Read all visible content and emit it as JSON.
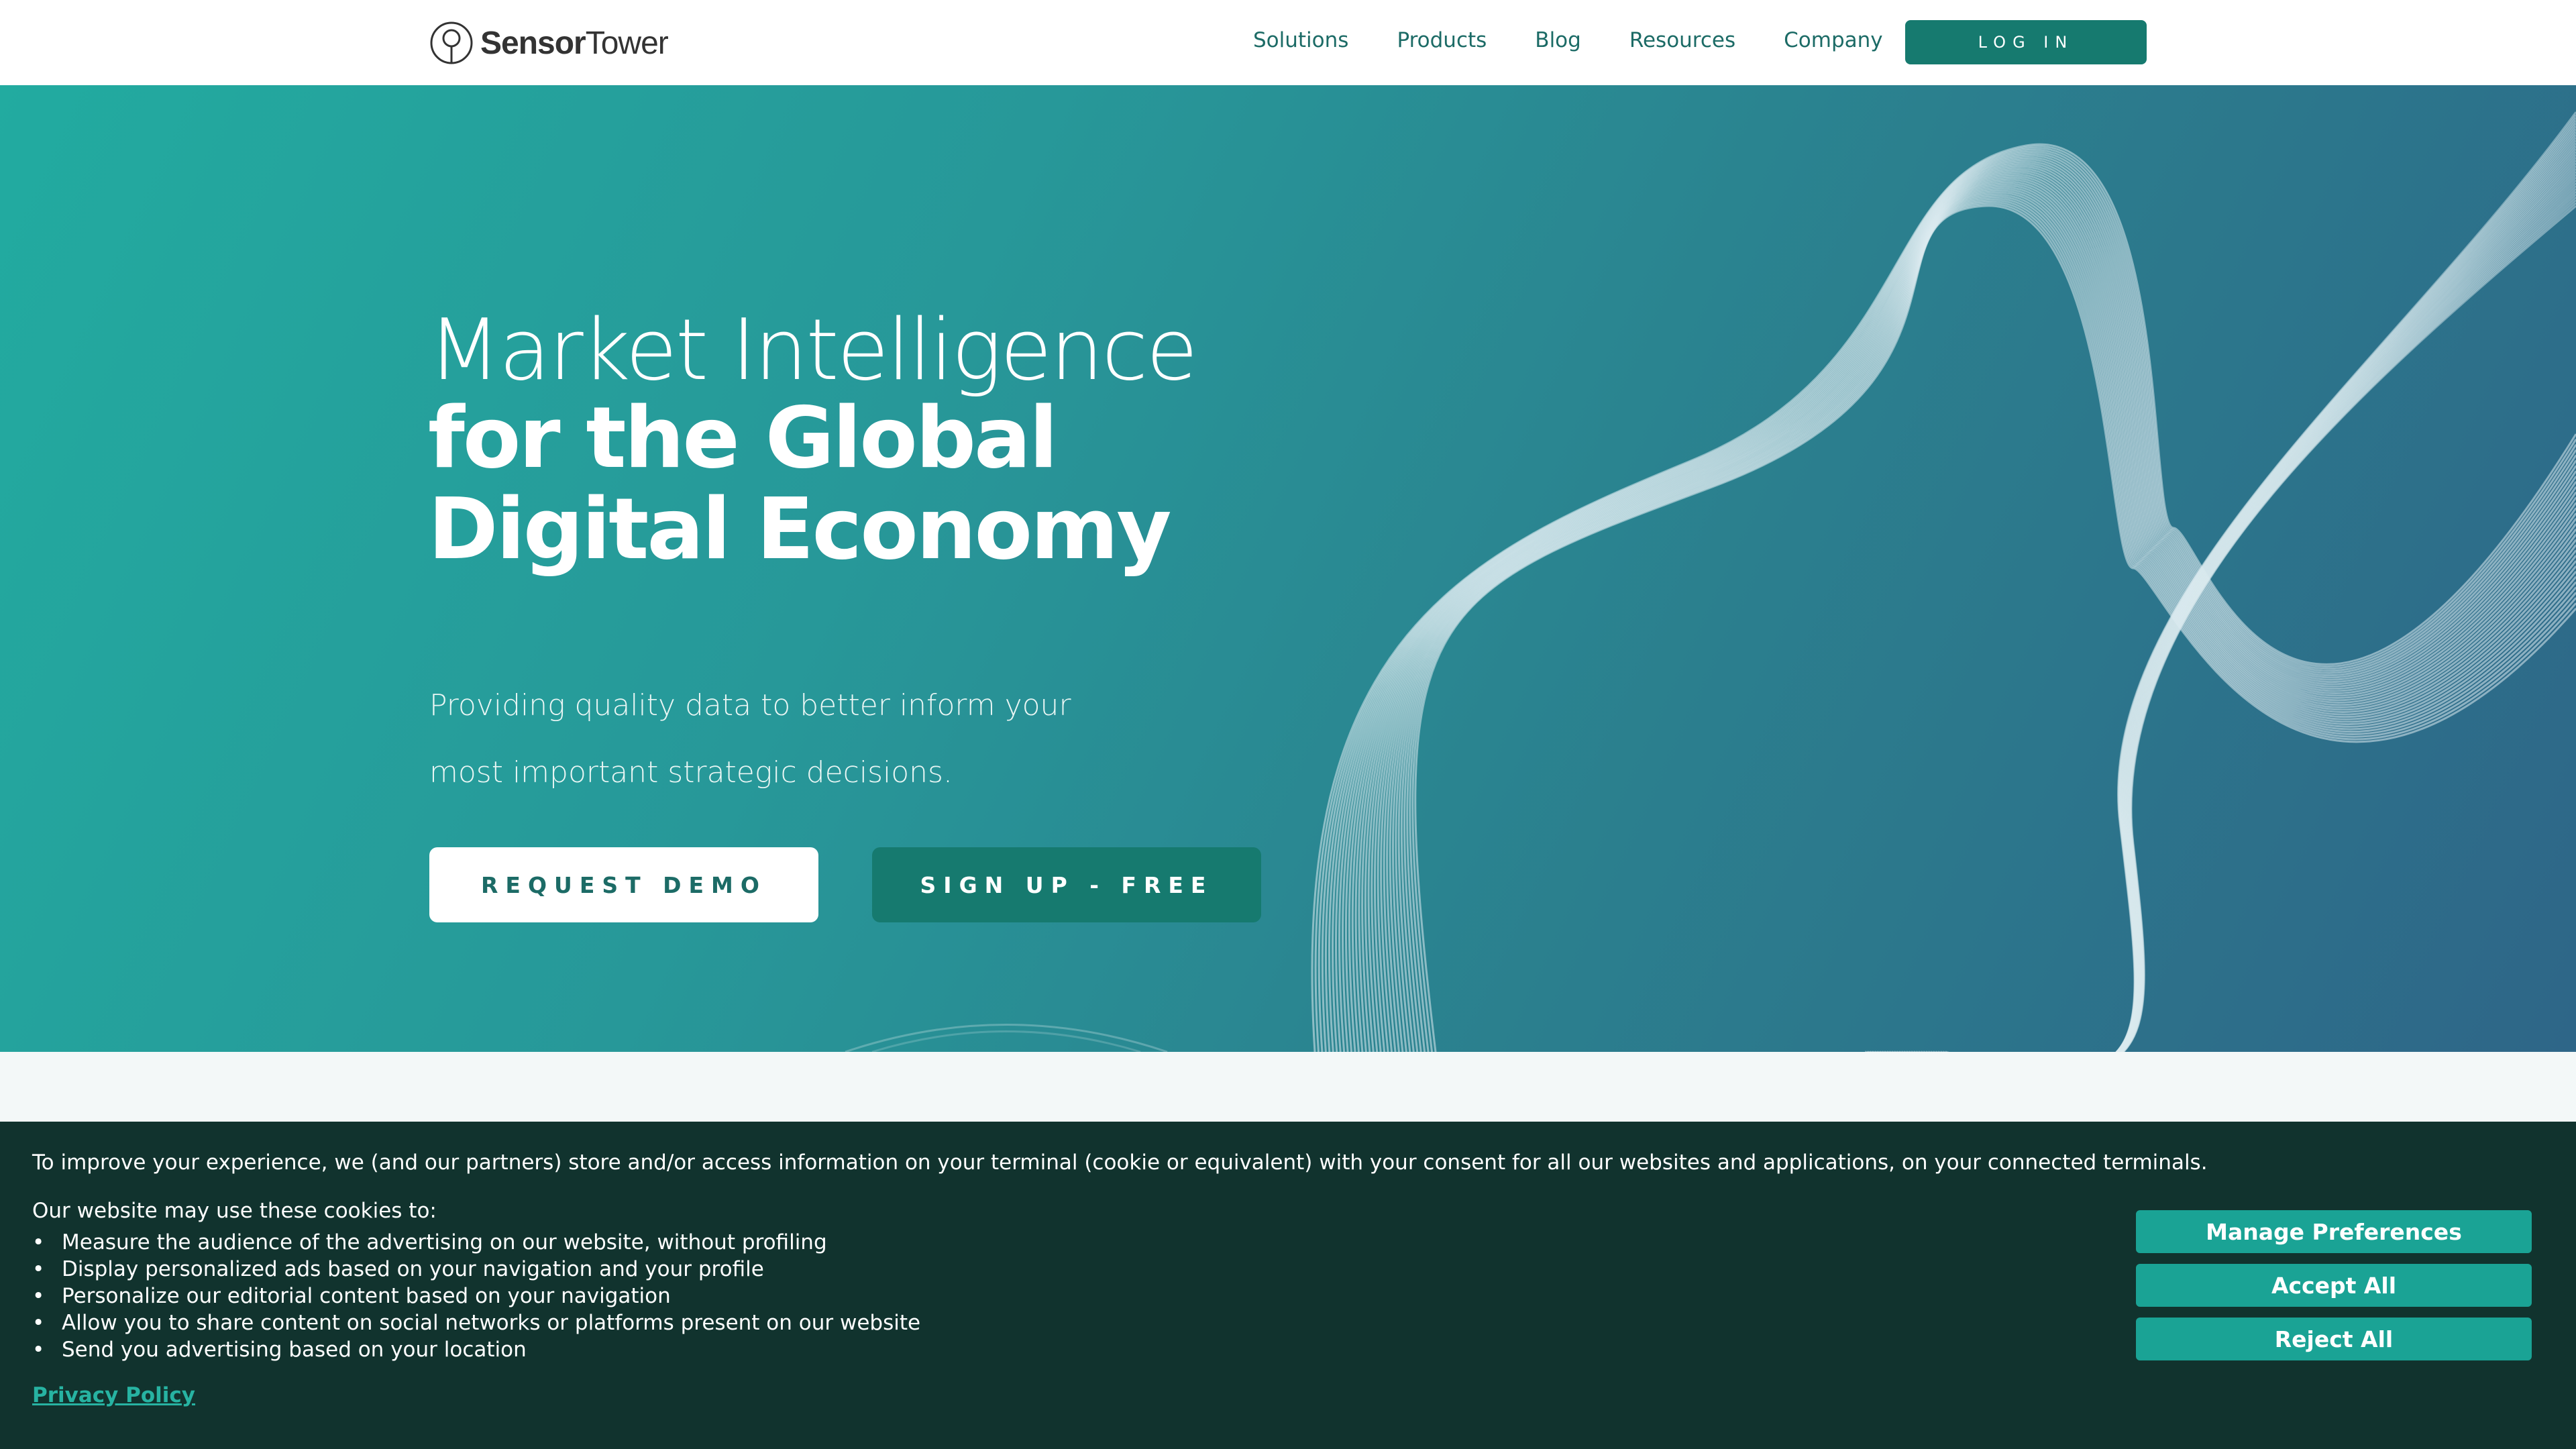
{
  "header": {
    "brand_bold": "Sensor",
    "brand_light": "Tower",
    "nav": [
      "Solutions",
      "Products",
      "Blog",
      "Resources",
      "Company"
    ],
    "login_label": "LOG IN"
  },
  "hero": {
    "title_line1": "Market Intelligence",
    "title_line2": "for the Global Digital Economy",
    "subtitle_line1": "Providing quality data to better inform your",
    "subtitle_line2": "most important strategic decisions.",
    "demo_label": "REQUEST DEMO",
    "signup_label": "SIGN UP - FREE",
    "gradient_start": "#22aba0",
    "gradient_end": "#2e6688"
  },
  "cookie": {
    "intro": "To improve your experience, we (and our partners) store and/or access information on your terminal (cookie or equivalent) with your consent for all our websites and applications, on your connected terminals.",
    "may_use": "Our website may use these cookies to:",
    "items": [
      "Measure the audience of the advertising on our website, without profiling",
      "Display personalized ads based on your navigation and your profile",
      "Personalize our editorial content based on your navigation",
      "Allow you to share content on social networks or platforms present on our website",
      "Send you advertising based on your location"
    ],
    "privacy_link": "Privacy Policy",
    "manage_label": "Manage Preferences",
    "accept_label": "Accept All",
    "reject_label": "Reject All",
    "background": "#11332e",
    "button_color": "#1aa395"
  }
}
